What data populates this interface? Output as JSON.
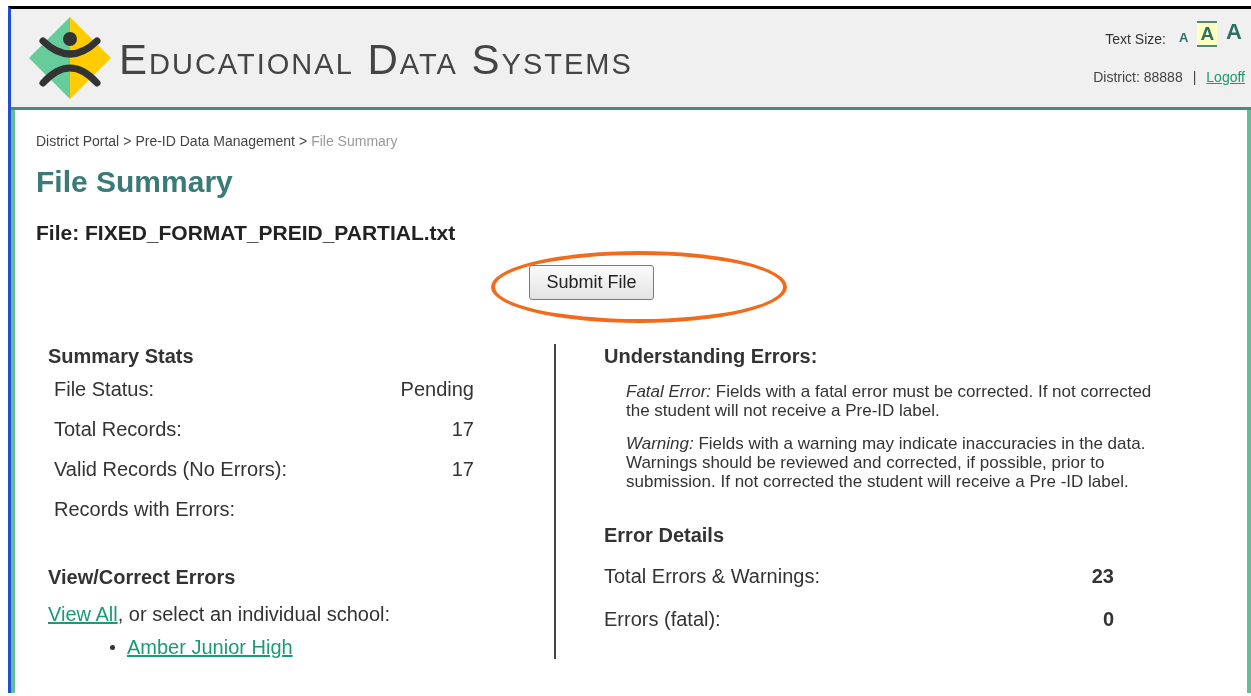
{
  "header": {
    "logo_text": "Educational Data Systems",
    "text_size": {
      "label": "Text Size:",
      "options": [
        {
          "label": "A",
          "selected": false
        },
        {
          "label": "A",
          "selected": true
        },
        {
          "label": "A",
          "selected": false
        }
      ]
    },
    "district": "District: 88888",
    "separator": "|",
    "logoff": "Logoff"
  },
  "breadcrumb": [
    {
      "label": "District Portal",
      "kind": "link",
      "current": false
    },
    {
      "label": ">",
      "kind": "sep"
    },
    {
      "label": "Pre-ID Data Management",
      "kind": "link",
      "current": false
    },
    {
      "label": ">",
      "kind": "sep"
    },
    {
      "label": "File Summary",
      "kind": "link",
      "current": true
    }
  ],
  "title": "File Summary",
  "file": "File: FIXED_FORMAT_PREID_PARTIAL.txt",
  "submit_button": "Submit File",
  "summary_stats": {
    "heading": "Summary Stats",
    "rows": [
      {
        "label": "File Status:",
        "value": "Pending"
      },
      {
        "label": "Total Records:",
        "value": "17"
      },
      {
        "label": "Valid Records (No Errors):",
        "value": "17"
      },
      {
        "label": "Records with Errors:"
      }
    ]
  },
  "view_correct": {
    "heading": "View/Correct Errors",
    "view_all": "View All",
    "text": ", or select an individual school:",
    "schools": [
      "Amber Junior High"
    ]
  },
  "understanding": {
    "heading": "Understanding Errors:",
    "items": [
      "*Fatal Error:* Fields with a fatal error must be corrected. If not corrected the student will not receive a Pre-ID label.",
      "*Warning:* Fields with a warning may indicate inaccuracies in the data. Warnings should be reviewed and corrected, if possible, prior to submission. If not corrected the student will receive a Pre -ID label."
    ]
  },
  "error_details": {
    "heading": "Error Details",
    "rows": [
      {
        "label": "Total Errors & Warnings:",
        "value": "23"
      },
      {
        "label": "Errors (fatal):",
        "value": "0"
      }
    ]
  }
}
